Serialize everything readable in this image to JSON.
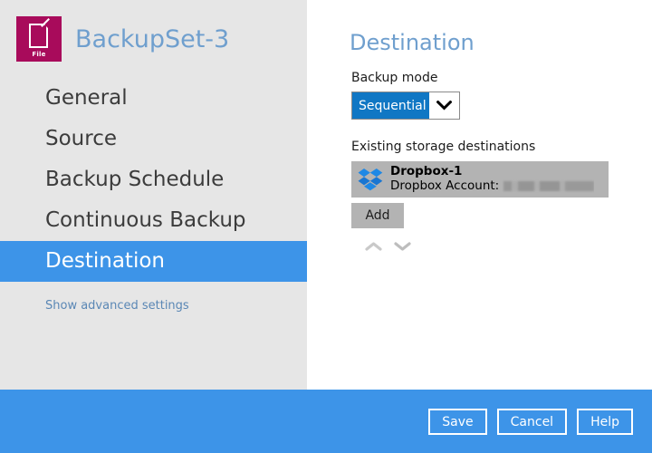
{
  "window": {
    "app_icon_caption": "File",
    "title": "BackupSet-3"
  },
  "sidebar": {
    "items": [
      {
        "label": "General",
        "selected": false
      },
      {
        "label": "Source",
        "selected": false
      },
      {
        "label": "Backup Schedule",
        "selected": false
      },
      {
        "label": "Continuous Backup",
        "selected": false
      },
      {
        "label": "Destination",
        "selected": true
      }
    ],
    "advanced_link": "Show advanced settings"
  },
  "main": {
    "panel_title": "Destination",
    "backup_mode": {
      "label": "Backup mode",
      "value": "Sequential",
      "options": [
        "Sequential"
      ]
    },
    "destinations": {
      "label": "Existing storage destinations",
      "rows": [
        {
          "name": "Dropbox-1",
          "account_label": "Dropbox Account:",
          "account_value": "",
          "icon": "dropbox-icon",
          "selected": true
        }
      ],
      "add_label": "Add",
      "move_up_icon": "chevron-up-icon",
      "move_down_icon": "chevron-down-icon"
    }
  },
  "footer": {
    "save_label": "Save",
    "cancel_label": "Cancel",
    "help_label": "Help"
  },
  "colors": {
    "accent_blue": "#3d94e8",
    "select_blue": "#1077c4",
    "title_blue": "#6f9fce",
    "sidebar_gray": "#e6e6e6",
    "row_gray": "#b3b3b3",
    "brand_magenta": "#a80b5b"
  }
}
